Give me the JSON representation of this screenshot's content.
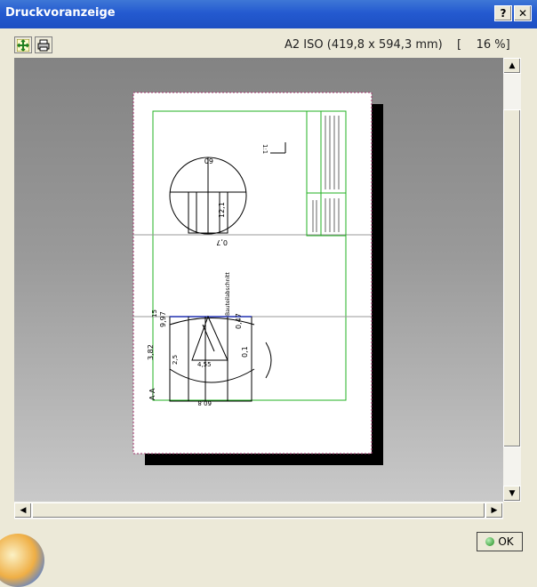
{
  "window": {
    "title": "Druckvoranzeige"
  },
  "titlebar": {
    "help_label": "?",
    "close_label": "✕"
  },
  "toolbar": {
    "fit_icon": "fit-page-icon",
    "print_icon": "printer-icon"
  },
  "preview": {
    "paper_format": "A2 ISO (419,8 x 594,3 mm)",
    "zoom_text": "[    16 %]"
  },
  "drawing": {
    "view_label": "A-A",
    "dim_60": "60",
    "dim_121": "12,1",
    "dim_07": "0,7",
    "dim_047": "0,47",
    "dim_01": "0,1",
    "dim_382": "3,82",
    "dim_997": "9,97",
    "dim_15": "15",
    "dim_25": "2,5",
    "dim_455": "4,55",
    "dim_608": "60,8",
    "note_1": "1:1",
    "note_vertical": "Bauteilabschnitt"
  },
  "scrollbar": {
    "up": "▲",
    "down": "▼",
    "left": "◀",
    "right": "▶"
  },
  "dialog": {
    "ok_label": "OK"
  },
  "colors": {
    "title_blue": "#245ad0",
    "frame_green": "#22b022",
    "canvas_gray": "#8e8e8e"
  }
}
